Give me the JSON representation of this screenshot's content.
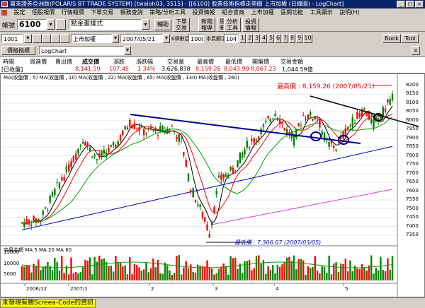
{
  "window": {
    "title": "寶來證券亞洲版(POLARIS BT TRADE SYSTEM) [twaloh03, 3515] - [[6100] 股票技術指標走勢圖 上市加權 (日線圖) - LogChart]",
    "min": "_",
    "max": "□",
    "close": "×"
  },
  "menu": [
    "設定",
    "個股報價",
    "行情報價",
    "下單交易",
    "帳務查詢",
    "策略/分析工具",
    "投資情報",
    "組合會商",
    "上市加權",
    "區間功能",
    "工具顯示",
    "說明(H)"
  ],
  "toolbar1": {
    "account_label": "帳號",
    "code": "6100",
    "mode_select": "點金畫樣式",
    "buttons": [
      "輔助",
      "下單交易",
      "新聞報導",
      "閱讀新聞",
      "分析工具",
      "投資情報"
    ]
  },
  "toolbar2": {
    "stock_code": "1001",
    "stock_name": "上市加權",
    "date": "2007/05/21",
    "date_unit_label": "K棒數目",
    "kbar_count": "1000",
    "display_label": "本頁顯示",
    "display_count": "104",
    "num_buttons": [
      "1",
      "2",
      "3",
      "4",
      "5",
      "6",
      "7",
      "8",
      "9",
      "10"
    ],
    "right_buttons": [
      "Book",
      "Tool"
    ]
  },
  "toolbar3": {
    "indicator_button": "價格指標",
    "chart_type": "LogChart"
  },
  "quote": {
    "headers": [
      "時間",
      "買進價",
      "賣出價",
      "成交價",
      "漲跌",
      "漲跌幅",
      "交易量",
      "最高價",
      "最低價",
      "開盤價",
      "交易金額"
    ],
    "values": [
      "[已收盤]",
      "",
      "",
      "8,141.59",
      "107.45",
      "1.34%",
      "3,626,838",
      "8,159.26",
      "8,043.90",
      "8,067.23",
      "1,044.59億"
    ]
  },
  "chart": {
    "ma_legend": "MA(收盤價 , 5)  MA(收盤價 , 10)  MA(收盤價 , 22)  MA(收盤價 , 65)  MA(收盤價 , 130)  MA(收盤價 , 260)",
    "price_ticks": [
      "8200",
      "8150",
      "8100",
      "8050",
      "8000",
      "7950",
      "7900",
      "7850",
      "7800",
      "7750",
      "7700",
      "7650",
      "7600",
      "7550",
      "7500",
      "7450",
      "7400",
      "7350"
    ],
    "high_annotation": "最高價 : 8,159.26 (2007/05/21)",
    "low_annotation": "最低價 : 7,306.07 (2007/03/05)",
    "volume_legend": "交易金額  MA 5  MA 20  MA 60",
    "volume_ticks": [
      "15000",
      "10000",
      "5000"
    ],
    "date_labels": [
      "2006/12",
      "2007/1",
      "2",
      "3",
      "4",
      "5"
    ],
    "colors": {
      "up": "#ff0000",
      "down": "#008000",
      "ma5": "#000000",
      "ma10": "#ff0000",
      "ma22": "#00a000",
      "ma65": "#0000c0",
      "ma130": "#e040e0",
      "trend": "#00008b"
    }
  },
  "status": {
    "text": "未發現有關Screea-Code的資訊"
  }
}
